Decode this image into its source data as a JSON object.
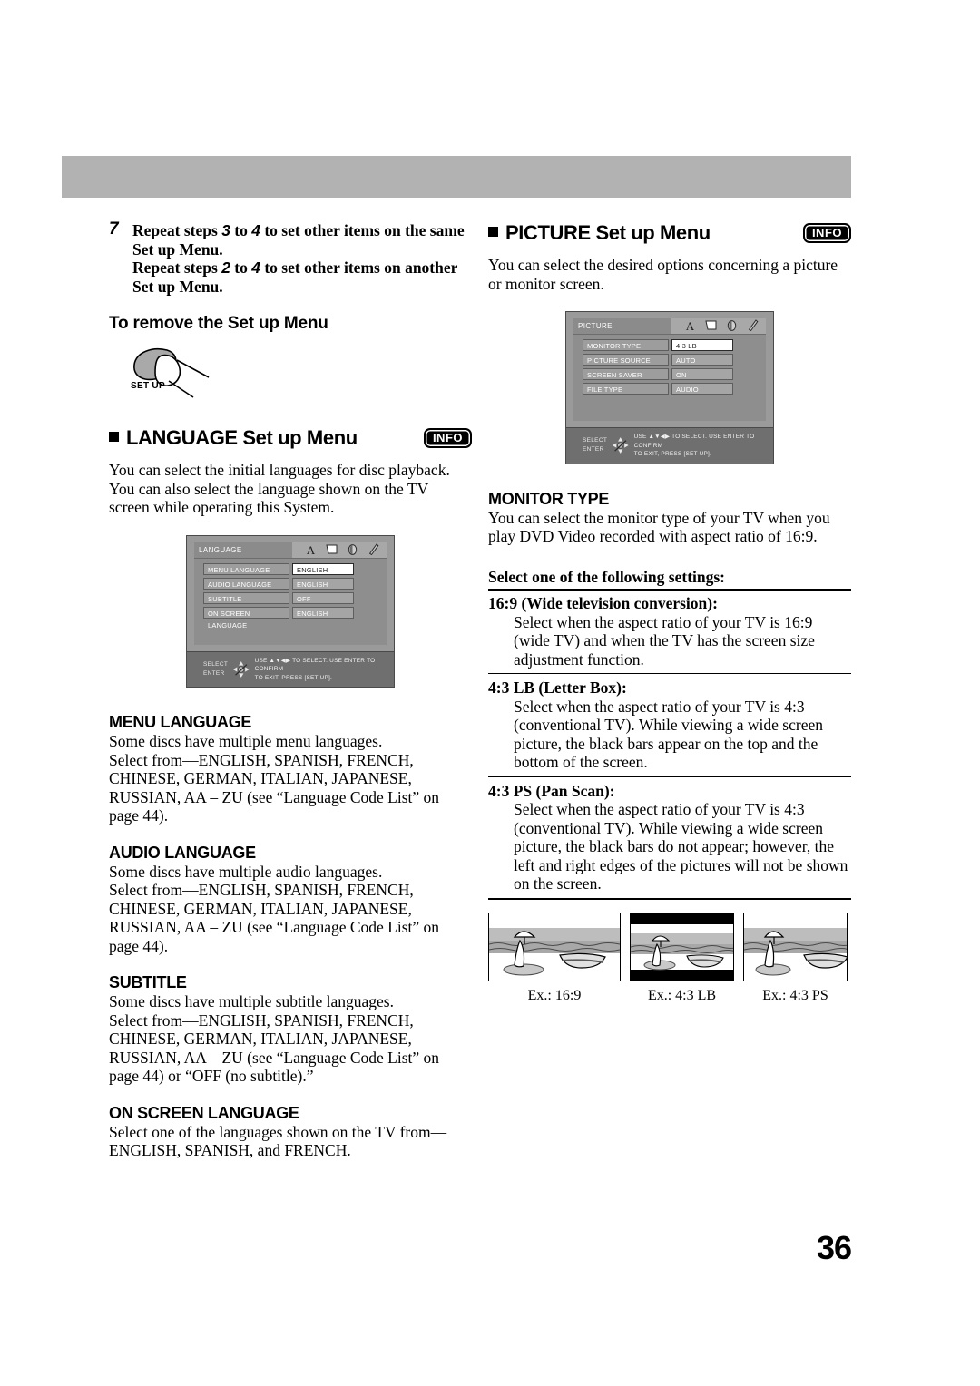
{
  "page": {
    "number": "36"
  },
  "left_column": {
    "step": {
      "number": "7",
      "line1_a": "Repeat steps ",
      "line1_n1": "3",
      "line1_b": " to ",
      "line1_n2": "4",
      "line1_c": " to set other items on the same Set up Menu.",
      "line2_a": "Repeat steps ",
      "line2_n1": "2",
      "line2_b": " to ",
      "line2_n2": "4",
      "line2_c": " to set other items on another Set up Menu."
    },
    "remove_heading": "To remove the Set up Menu",
    "setup_button_label": "SET UP",
    "language_section": {
      "title": "LANGUAGE Set up Menu",
      "info_badge": "INFO",
      "intro": "You can select the initial languages for disc playback. You can also select the language shown on the TV screen while operating this System.",
      "osd": {
        "tab_title": "LANGUAGE",
        "rows": [
          {
            "label": "MENU LANGUAGE",
            "value": "ENGLISH",
            "selected": true
          },
          {
            "label": "AUDIO LANGUAGE",
            "value": "ENGLISH",
            "selected": false
          },
          {
            "label": "SUBTITLE",
            "value": "OFF",
            "selected": false
          },
          {
            "label": "ON SCREEN LANGUAGE",
            "value": "ENGLISH",
            "selected": false
          }
        ],
        "nav": {
          "select_label": "SELECT",
          "enter_label": "ENTER",
          "line1": "USE ▲▼◀▶ TO SELECT.  USE ENTER TO CONFIRM",
          "line2": "TO EXIT, PRESS [SET UP]."
        },
        "tab_icons": [
          "letter-a-icon",
          "screen-icon",
          "disc-icon",
          "wrench-icon"
        ]
      },
      "properties": [
        {
          "heading": "MENU LANGUAGE",
          "line1": "Some discs have multiple menu languages.",
          "line2": "Select from—ENGLISH, SPANISH, FRENCH, CHINESE, GERMAN, ITALIAN, JAPANESE, RUSSIAN, AA – ZU (see “Language Code List” on page 44)."
        },
        {
          "heading": "AUDIO LANGUAGE",
          "line1": "Some discs have multiple audio languages.",
          "line2": "Select from—ENGLISH, SPANISH, FRENCH, CHINESE, GERMAN, ITALIAN, JAPANESE, RUSSIAN, AA – ZU (see “Language Code List” on page 44)."
        },
        {
          "heading": "SUBTITLE",
          "line1": "Some discs have multiple subtitle languages.",
          "line2": "Select from—ENGLISH, SPANISH, FRENCH, CHINESE, GERMAN, ITALIAN, JAPANESE, RUSSIAN, AA – ZU (see “Language Code List” on page 44) or “OFF (no subtitle).”"
        },
        {
          "heading": "ON SCREEN LANGUAGE",
          "line1": "Select one of the languages shown on the TV from—ENGLISH, SPANISH, and FRENCH.",
          "line2": ""
        }
      ]
    }
  },
  "right_column": {
    "picture_section": {
      "title": "PICTURE Set up Menu",
      "info_badge": "INFO",
      "intro": "You can select the desired options concerning a picture or monitor screen.",
      "osd": {
        "tab_title": "PICTURE",
        "rows": [
          {
            "label": "MONITOR TYPE",
            "value": "4:3 LB",
            "selected": true
          },
          {
            "label": "PICTURE SOURCE",
            "value": "AUTO",
            "selected": false
          },
          {
            "label": "SCREEN SAVER",
            "value": "ON",
            "selected": false
          },
          {
            "label": "FILE TYPE",
            "value": "AUDIO",
            "selected": false
          }
        ],
        "nav": {
          "select_label": "SELECT",
          "enter_label": "ENTER",
          "line1": "USE ▲▼◀▶ TO SELECT.  USE ENTER TO CONFIRM",
          "line2": "TO EXIT, PRESS [SET UP]."
        },
        "tab_icons": [
          "letter-a-icon",
          "screen-icon",
          "disc-icon",
          "wrench-icon"
        ]
      },
      "monitor_type": {
        "heading": "MONITOR TYPE",
        "intro": "You can select the monitor type of your TV when you play DVD Video recorded with aspect ratio of 16:9.",
        "select_label": "Select one of the following settings:",
        "settings": [
          {
            "term": "16:9 (Wide television conversion):",
            "desc": "Select when the aspect ratio of your TV is 16:9 (wide TV) and when the TV has the screen size adjustment function."
          },
          {
            "term": "4:3 LB (Letter Box):",
            "desc": "Select when the aspect ratio of your TV is 4:3 (conventional TV). While viewing a wide screen picture, the black bars appear on the top and the bottom of the screen."
          },
          {
            "term": "4:3 PS (Pan Scan):",
            "desc": "Select when the aspect ratio of your TV is 4:3 (conventional TV). While viewing a wide screen picture, the black bars do not appear; however, the left and right edges of the pictures will not be shown on the screen."
          }
        ],
        "examples": [
          {
            "caption": "Ex.: 16:9",
            "style": "wide"
          },
          {
            "caption": "Ex.: 4:3 LB",
            "style": "letterbox"
          },
          {
            "caption": "Ex.: 4:3 PS",
            "style": "panscan"
          }
        ]
      }
    }
  },
  "colors": {
    "header_band": "#b2b2b2",
    "osd_background": "#8e8e8e",
    "osd_nav_background": "#6f6f6f",
    "osd_selected_value": "#ffffff"
  }
}
